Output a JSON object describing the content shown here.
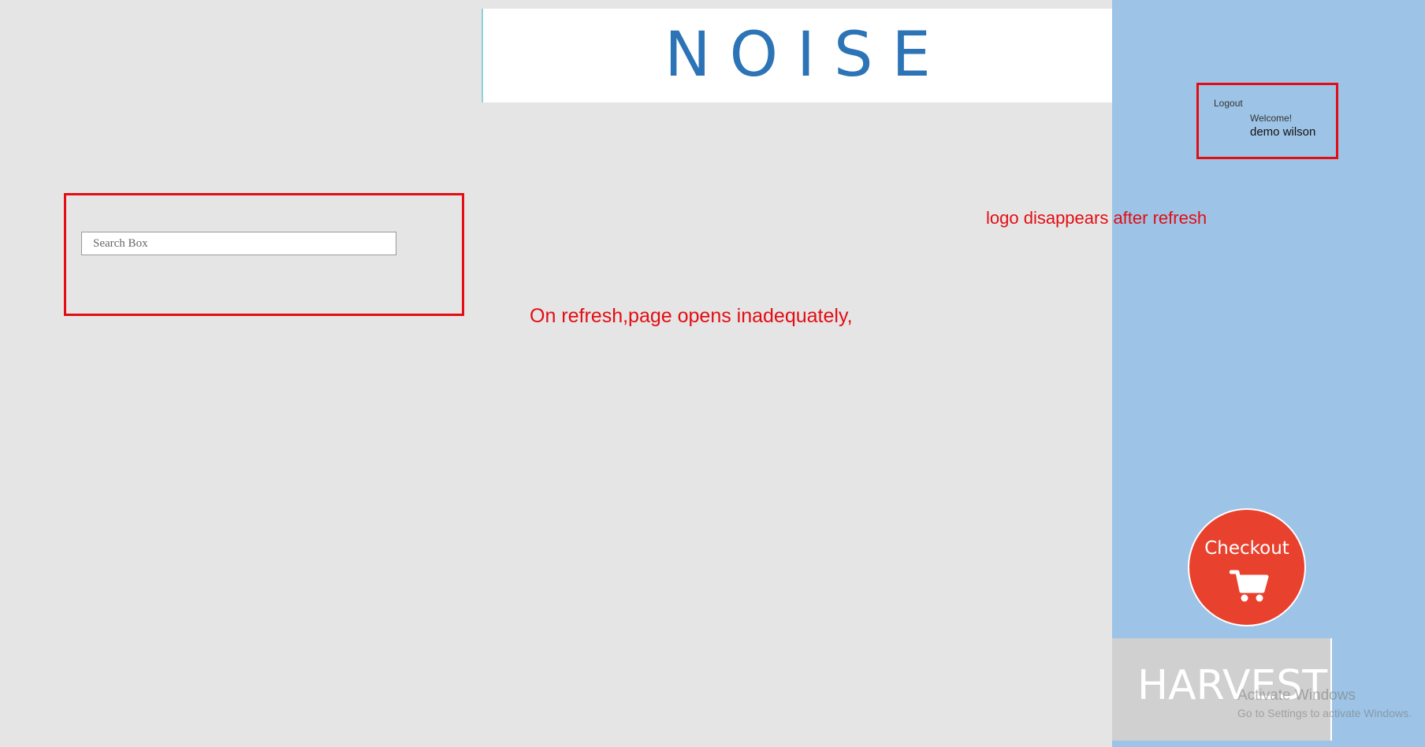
{
  "header": {
    "brand_title": "NOISE"
  },
  "search": {
    "placeholder": "Search Box"
  },
  "user": {
    "logout_label": "Logout",
    "welcome_label": "Welcome!",
    "name": "demo wilson"
  },
  "annotations": {
    "logo_note": "logo disappears after refresh",
    "refresh_note": "On refresh,page opens inadequately,"
  },
  "checkout": {
    "label": "Checkout",
    "icon": "cart-icon"
  },
  "harvest": {
    "label": "HARVEST"
  },
  "watermark": {
    "title": "Activate Windows",
    "subtitle": "Go to Settings to activate Windows."
  },
  "colors": {
    "background": "#e5e5e5",
    "sidebar": "#9dc3e6",
    "brand": "#2c74b6",
    "annotation": "#e30d13",
    "checkout": "#e8412e",
    "harvest_tile": "#d0d0d0"
  }
}
